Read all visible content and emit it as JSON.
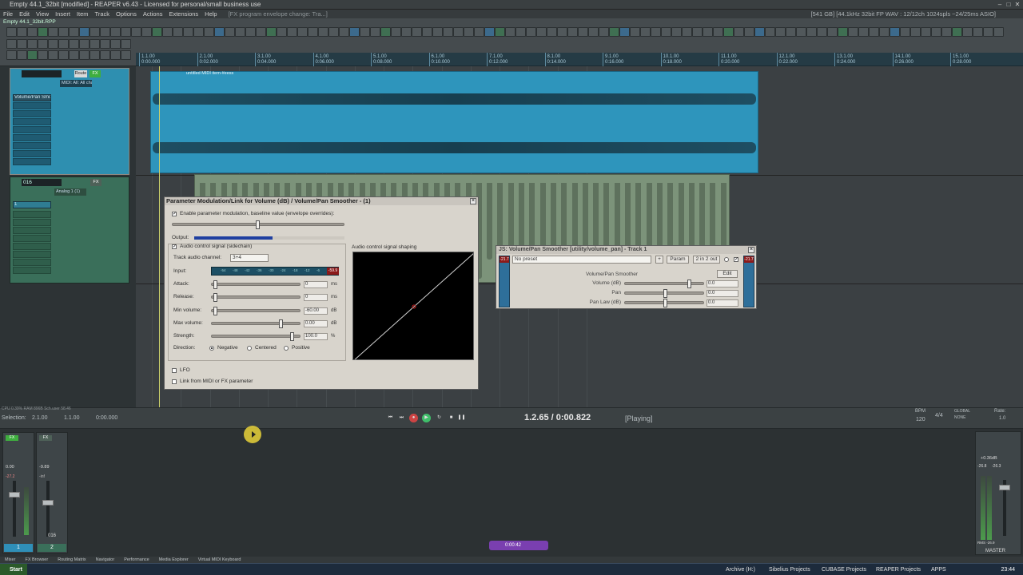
{
  "window": {
    "title": "Empty 44.1_32bit [modified] - REAPER v6.43 - Licensed for personal/small business use"
  },
  "menu": {
    "items": [
      "File",
      "Edit",
      "View",
      "Insert",
      "Item",
      "Track",
      "Options",
      "Actions",
      "Extensions",
      "Help"
    ],
    "hint": "[FX program envelope change: Tra...]",
    "status": "[541 GB] [44.1kHz 32bit FP WAV : 12/12ch 1024spls ~24/25ms ASIO]"
  },
  "project": {
    "tab": "Empty 44.1_32bit.RPP"
  },
  "ruler": {
    "marks": [
      "1.1.00",
      "2.1.00",
      "3.1.00",
      "4.1.00",
      "5.1.00",
      "6.1.00",
      "7.1.00",
      "8.1.00",
      "9.1.00",
      "10.1.00",
      "11.1.00",
      "12.1.00",
      "13.1.00",
      "14.1.00",
      "15.1.00"
    ],
    "subs": [
      "0:00.000",
      "0:02.000",
      "0:04.000",
      "0:06.000",
      "0:08.000",
      "0:10.000",
      "0:12.000",
      "0:14.000",
      "0:16.000",
      "0:18.000",
      "0:20.000",
      "0:22.000",
      "0:24.000",
      "0:26.000",
      "0:28.000"
    ]
  },
  "tracks": [
    {
      "num": "1",
      "name": "",
      "route": "Route",
      "input": "MIDI: All: All cha",
      "fx": "Volume/Pan Smoot"
    },
    {
      "num": "2",
      "name": "016",
      "route": "",
      "input": "Analog 1 (1)",
      "fx": "1"
    }
  ],
  "items": {
    "item1_label": "untitled MIDI item-#eess"
  },
  "transport": {
    "cpu": "CPU 0.39% RAM 896B Sch.user 58.46",
    "selection_label": "Selection:",
    "sel_start": "2.1.00",
    "sel_end": "1.1.00",
    "sel_len": "0:00.000",
    "position": "1.2.65 / 0:00.822",
    "state": "[Playing]",
    "bpm_label": "BPM",
    "bpm": "120",
    "ts": "4/4",
    "rate_label": "Rate:",
    "rate": "1.0",
    "global": "GLOBAL",
    "none": "NONE"
  },
  "param_mod": {
    "title": "Parameter Modulation/Link for Volume (dB) / Volume/Pan Smoother - (1)",
    "enable_label": "Enable parameter modulation, baseline value (envelope overrides):",
    "output_label": "Output:",
    "acs_label": "Audio control signal (sidechain)",
    "track_ch_label": "Track audio channel:",
    "track_ch": "3+4",
    "input_label": "Input:",
    "input_peak": "-59.9",
    "meter_ticks": [
      "-54",
      "-48",
      "-42",
      "-36",
      "-30",
      "-24",
      "-18",
      "-12",
      "-6"
    ],
    "attack_label": "Attack:",
    "attack": "0",
    "attack_unit": "ms",
    "release_label": "Release:",
    "release": "0",
    "release_unit": "ms",
    "minvol_label": "Min volume:",
    "minvol": "-60.00",
    "minvol_unit": "dB",
    "maxvol_label": "Max volume:",
    "maxvol": "0.00",
    "maxvol_unit": "dB",
    "strength_label": "Strength:",
    "strength": "100.0",
    "strength_unit": "%",
    "direction_label": "Direction:",
    "dir_neg": "Negative",
    "dir_cen": "Centered",
    "dir_pos": "Positive",
    "shaping_label": "Audio control signal shaping",
    "lfo_label": "LFO",
    "link_label": "Link from MIDI or FX parameter"
  },
  "js_window": {
    "title": "JS: Volume/Pan Smoother [utility/volume_pan] - Track 1",
    "preset": "No preset",
    "plus": "+",
    "param_btn": "Param",
    "io_btn": "2 in 2 out",
    "peak_l": "-21.7",
    "peak_r": "-21.7",
    "plugin_name": "Volume/Pan Smoother",
    "edit_btn": "Edit",
    "params": [
      {
        "label": "Volume (dB)",
        "value": "0.0"
      },
      {
        "label": "Pan",
        "value": "0.0"
      },
      {
        "label": "Pan Law (dB)",
        "value": "0.0"
      }
    ]
  },
  "mixer": {
    "strips": [
      {
        "name": "",
        "num": "1",
        "vol": "0.00",
        "pk": "-27.2"
      },
      {
        "name": "016",
        "num": "2",
        "vol": "-9.89",
        "pk": "-inf"
      }
    ],
    "master": {
      "label": "MASTER",
      "vol": "+0.36dB",
      "pk_l": "-26.8",
      "pk_r": "-26.3",
      "rms": "RMS -26.9"
    }
  },
  "recorder": {
    "time": "0:00:42"
  },
  "bottom_tabs": [
    "Mixer",
    "FX Browser",
    "Routing Matrix",
    "Navigator",
    "Performance",
    "Media Explorer",
    "Virtual MIDI Keyboard"
  ],
  "taskbar": {
    "start": "Start",
    "items": [
      "Archive (H:)",
      "Sibelius Projects",
      "CUBASE Projects",
      "REAPER Projects",
      "APPS"
    ],
    "clock": "23:44"
  }
}
